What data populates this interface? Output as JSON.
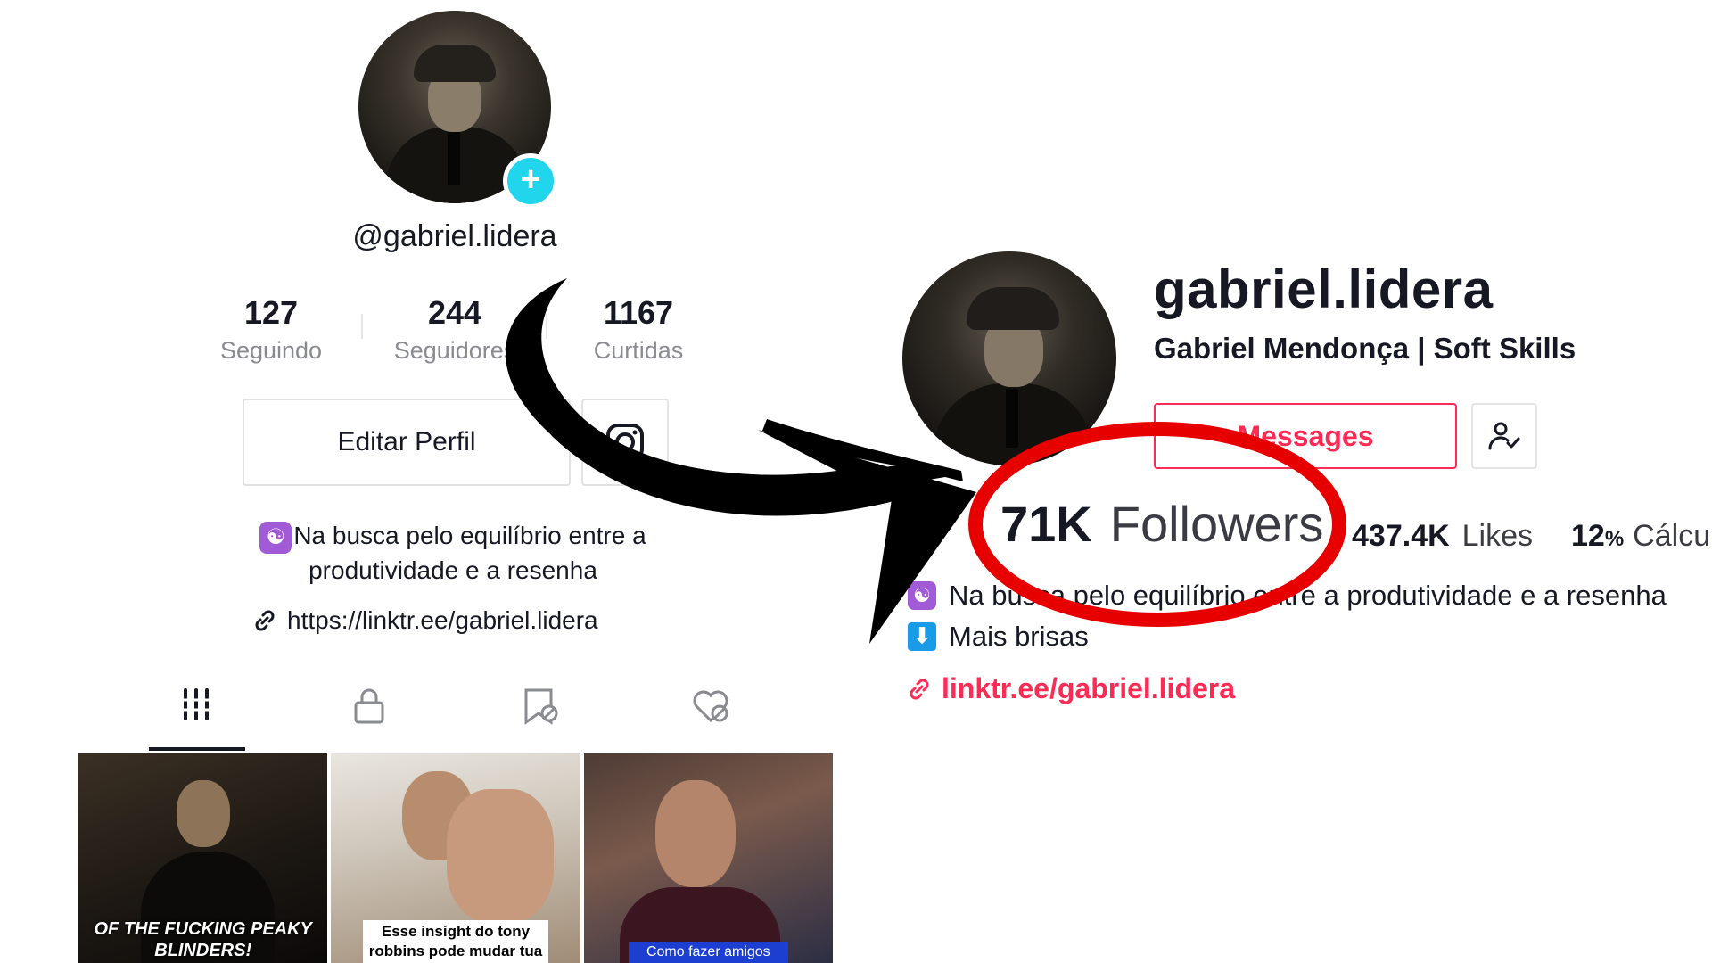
{
  "mobile_profile": {
    "username": "@gabriel.lidera",
    "add_icon": "plus-icon",
    "stats": [
      {
        "value": "127",
        "label": "Seguindo"
      },
      {
        "value": "244",
        "label": "Seguidores"
      },
      {
        "value": "1167",
        "label": "Curtidas"
      }
    ],
    "edit_button": "Editar Perfil",
    "instagram_icon": "instagram-icon",
    "bio_emoji": "☯",
    "bio_line1": "Na busca pelo equilíbrio entre a",
    "bio_line2": "produtividade e a resenha",
    "link": "https://linktr.ee/gabriel.lidera",
    "tabs": [
      "videos-grid-icon",
      "lock-icon",
      "saved-icon",
      "liked-icon"
    ],
    "thumbnails": [
      {
        "caption": "OF THE FUCKING PEAKY BLINDERS!"
      },
      {
        "caption": "Esse insight do tony robbins pode mudar tua"
      },
      {
        "caption": "Como fazer amigos"
      }
    ]
  },
  "web_profile": {
    "title": "gabriel.lidera",
    "subtitle": "Gabriel Mendonça | Soft Skills",
    "messages_button": "Messages",
    "friend_icon": "user-check-icon",
    "followers_value": "71K",
    "followers_label": "Followers",
    "likes_value": "437.4K",
    "likes_label": "Likes",
    "calc_value": "12",
    "calc_unit": "%",
    "calc_label": "Cálculo",
    "bio_emoji1": "☯",
    "bio_line1": "Na busca pelo equilíbrio entre a produtividade e a resenha",
    "bio_emoji2": "⬇",
    "bio_line2": "Mais brisas",
    "link": "linktr.ee/gabriel.lidera"
  },
  "annotations": {
    "arrow_color": "#000000",
    "circle_color": "#e60000"
  }
}
